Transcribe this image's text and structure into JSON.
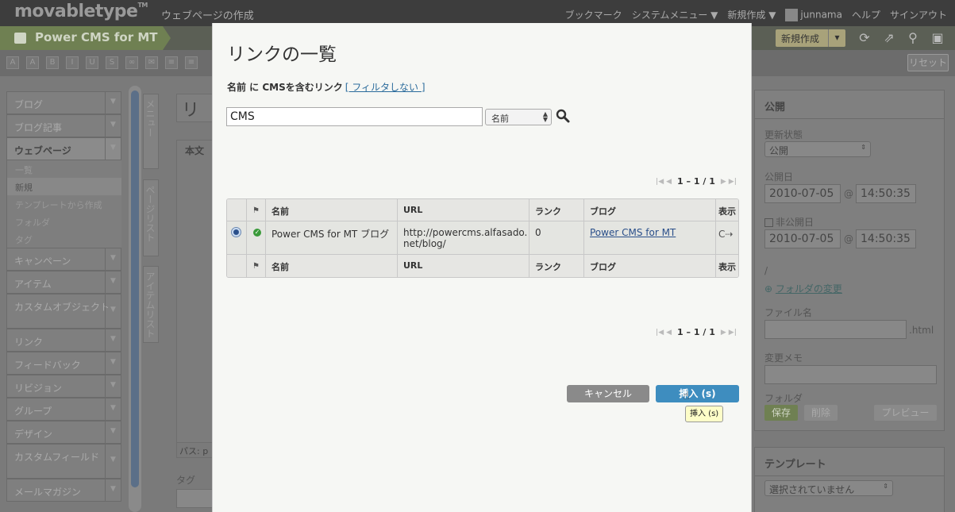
{
  "app": {
    "logo": "movabletype",
    "logo_tm": "TM",
    "page_heading": "ウェブページの作成",
    "topnav": [
      "ブックマーク",
      "システムメニュー ▼",
      "新規作成 ▼",
      "junnama",
      "ヘルプ",
      "サインアウト"
    ],
    "blog_name": "Power CMS for MT",
    "new_button": "新規作成",
    "reset_button": "リセット"
  },
  "left_menu": {
    "items_top": [
      "ブログ",
      "ブログ記事"
    ],
    "active": "ウェブページ",
    "subitems": [
      "一覧",
      "新規",
      "テンプレートから作成",
      "フォルダ",
      "タグ"
    ],
    "items_bottom": [
      "キャンペーン",
      "アイテム",
      "カスタムオブジェクト",
      "リンク",
      "フィードバック",
      "リビジョン",
      "グループ",
      "デザイン",
      "カスタムフィールド",
      "メールマガジン"
    ]
  },
  "vertical_tabs": [
    "メニュー",
    "ページリスト",
    "アイテムリスト"
  ],
  "editor": {
    "title_fragment": "リン",
    "body_tab": "本文",
    "path_label": "パス: p",
    "tags_label": "タグ"
  },
  "publish_panel": {
    "title": "公開",
    "status_label": "更新状態",
    "status_value": "公開",
    "date_label": "公開日",
    "date": "2010-07-05",
    "time": "14:50:35",
    "unpublish_label": "非公開日",
    "unpublish_date": "2010-07-05",
    "unpublish_time": "14:50:35",
    "path": "/",
    "change_folder": "フォルダの変更",
    "filename_label": "ファイル名",
    "ext": ".html",
    "memo_label": "変更メモ",
    "folder_label": "フォルダ",
    "save": "保存",
    "delete": "削除",
    "preview": "プレビュー"
  },
  "template_panel": {
    "title": "テンプレート",
    "select_value": "選択されていません"
  },
  "modal": {
    "title": "リンクの一覧",
    "filter_text": "名前 に CMSを含むリンク",
    "filter_link": "[ フィルタしない ]",
    "search_value": "CMS",
    "search_field": "名前",
    "pager": "1 – 1 / 1",
    "columns": [
      "",
      "",
      "名前",
      "URL",
      "ランク",
      "ブログ",
      "表示"
    ],
    "rows": [
      {
        "name": "Power CMS for MT ブログ",
        "url": "http://powercms.alfasado.net/blog/",
        "rank": "0",
        "blog": "Power CMS for MT"
      }
    ],
    "cancel": "キャンセル",
    "insert": "挿入 (s)",
    "tooltip": "挿入 (s)"
  }
}
